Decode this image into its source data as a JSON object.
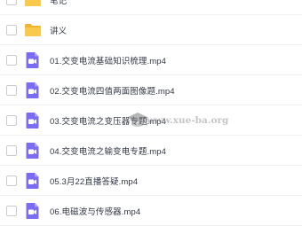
{
  "files": [
    {
      "name": "笔记",
      "type": "folder",
      "icon": "folder-icon"
    },
    {
      "name": "讲义",
      "type": "folder",
      "icon": "folder-icon"
    },
    {
      "name": "01.交变电流基础知识梳理.mp4",
      "type": "video",
      "icon": "video-file-icon"
    },
    {
      "name": "02.交变电流四值两面图像题.mp4",
      "type": "video",
      "icon": "video-file-icon"
    },
    {
      "name": "03.交变电流之变压器专题.mp4",
      "type": "video",
      "icon": "video-file-icon"
    },
    {
      "name": "04.交变电流之输变电专题.mp4",
      "type": "video",
      "icon": "video-file-icon"
    },
    {
      "name": "05.3月22直播答疑.mp4",
      "type": "video",
      "icon": "video-file-icon"
    },
    {
      "name": "06.电磁波与传感器.mp4",
      "type": "video",
      "icon": "video-file-icon"
    }
  ],
  "watermark": {
    "text": "www.xue-ba.org",
    "icon": "graduation-cap-icon"
  },
  "colors": {
    "folder": "#f8c94a",
    "folder_dark": "#eeb631",
    "video": "#7b6cf4",
    "text": "#333845",
    "checkbox_border": "#c8cbd2",
    "divider": "#f0f0f3"
  }
}
